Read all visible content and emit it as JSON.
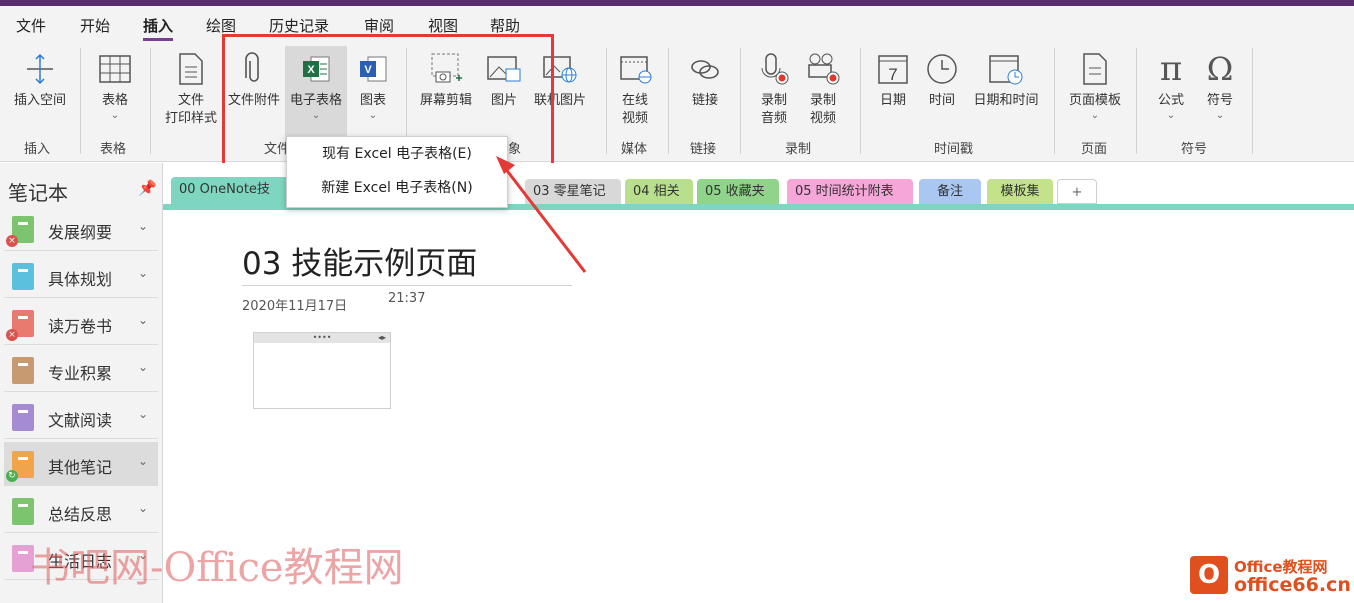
{
  "menu": [
    "文件",
    "开始",
    "插入",
    "绘图",
    "历史记录",
    "审阅",
    "视图",
    "帮助"
  ],
  "ribbon": {
    "insert_space": "插入空间",
    "table": "表格",
    "file_printout_l1": "文件",
    "file_printout_l2": "打印样式",
    "file_attachment": "文件附件",
    "spreadsheet": "电子表格",
    "chart": "图表",
    "screen_clipping": "屏幕剪辑",
    "picture": "图片",
    "online_picture": "联机图片",
    "online_video_l1": "在线",
    "online_video_l2": "视频",
    "link": "链接",
    "record_audio_l1": "录制",
    "record_audio_l2": "音频",
    "record_video_l1": "录制",
    "record_video_l2": "视频",
    "date": "日期",
    "time": "时间",
    "date_and_time": "日期和时间",
    "page_template": "页面模板",
    "equation": "公式",
    "symbol": "符号",
    "caret": "⌄"
  },
  "groups": {
    "insert": "插入",
    "tables": "表格",
    "files": "文件",
    "images": "象",
    "media": "媒体",
    "links": "链接",
    "recording": "录制",
    "timestamp": "时间戳",
    "pages": "页面",
    "symbols": "符号"
  },
  "dropdown": {
    "existing": "现有 Excel 电子表格(E)",
    "new": "新建 Excel 电子表格(N)"
  },
  "sidebar": {
    "title": "笔记本",
    "pin": "📌",
    "items": [
      {
        "label": "发展纲要",
        "color": "#7cc46e"
      },
      {
        "label": "具体规划",
        "color": "#5bc0de"
      },
      {
        "label": "读万卷书",
        "color": "#e87a6f"
      },
      {
        "label": "专业积累",
        "color": "#c79a72"
      },
      {
        "label": "文献阅读",
        "color": "#a58bd2"
      },
      {
        "label": "其他笔记",
        "color": "#f0a54d"
      },
      {
        "label": "总结反思",
        "color": "#7cc46e"
      },
      {
        "label": "生活日志",
        "color": "#e6a1d4"
      }
    ],
    "chevron": "⌄"
  },
  "tabs": [
    {
      "label": "00 OneNote技",
      "color": "#7ed6c0"
    },
    {
      "label": "03 零星笔记",
      "color": "#d8d8d8"
    },
    {
      "label": "04 相关",
      "color": "#b8e08c"
    },
    {
      "label": "05 收藏夹",
      "color": "#8fd48a"
    },
    {
      "label": "05 时间统计附表",
      "color": "#f6a6d8"
    },
    {
      "label": "备注",
      "color": "#a9c7f0"
    },
    {
      "label": "模板集",
      "color": "#c3e28a"
    },
    {
      "label": "+",
      "color": "#ffffff"
    }
  ],
  "page": {
    "title": "03 技能示例页面",
    "date": "2020年11月17日",
    "time": "21:37",
    "object_handle": "••••",
    "object_arrows": "◂▸"
  },
  "watermark": "书吧网-Office教程网",
  "logo": {
    "line1": "Office教程网",
    "line2": "office66.cn",
    "mark": "O"
  },
  "colors": {
    "accent": "#7a3e91",
    "highlight": "#e53935"
  }
}
